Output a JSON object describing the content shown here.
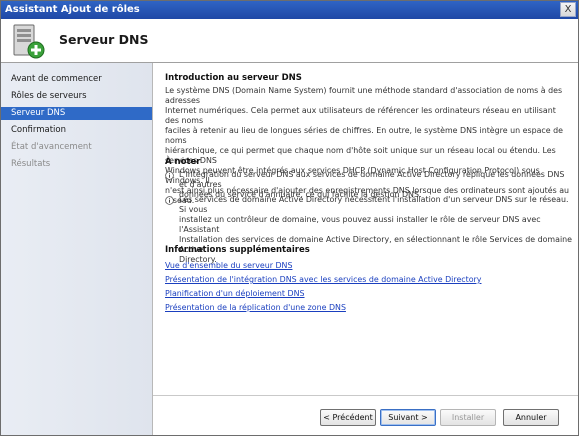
{
  "window": {
    "title": "Assistant Ajout de rôles",
    "close_label": "X"
  },
  "header": {
    "title": "Serveur DNS",
    "icon": "server-add-icon"
  },
  "sidebar": {
    "items": [
      {
        "label": "Avant de commencer",
        "state": "normal"
      },
      {
        "label": "Rôles de serveurs",
        "state": "normal"
      },
      {
        "label": "Serveur DNS",
        "state": "active"
      },
      {
        "label": "Confirmation",
        "state": "normal"
      },
      {
        "label": "État d'avancement",
        "state": "disabled"
      },
      {
        "label": "Résultats",
        "state": "disabled"
      }
    ]
  },
  "content": {
    "intro_heading": "Introduction au serveur DNS",
    "intro_lines": [
      "Le système DNS (Domain Name System) fournit une méthode standard d'association de noms à des adresses",
      "Internet numériques. Cela permet aux utilisateurs de référencer les ordinateurs réseau en utilisant des noms",
      "faciles à retenir au lieu de longues séries de chiffres. En outre, le système DNS intègre un espace de noms",
      "hiérarchique, ce qui permet que chaque nom d'hôte soit unique sur un réseau local ou étendu. Les services DNS",
      "Windows peuvent être intégrés aux services DHCP (Dynamic Host Configuration Protocol) sous Windows. Il",
      "n'est ainsi plus nécessaire d'ajouter des enregistrements DNS lorsque des ordinateurs sont ajoutés au réseau."
    ],
    "notes_heading": "À noter",
    "notes": [
      {
        "icon": "info-icon",
        "lines": [
          "L'intégration du serveur DNS aux services de domaine Active Directory réplique les données DNS et d'autres",
          "données du service d'annuaire, ce qui facilite la gestion DNS."
        ]
      },
      {
        "icon": "info-icon",
        "lines": [
          "Les services de domaine Active Directory nécessitent l'installation d'un serveur DNS sur le réseau. Si vous",
          "installez un contrôleur de domaine, vous pouvez aussi installer le rôle de serveur DNS avec l'Assistant",
          "Installation des services de domaine Active Directory, en sélectionnant le rôle Services de domaine Active",
          "Directory."
        ]
      }
    ],
    "more_heading": "Informations supplémentaires",
    "links": [
      "Vue d'ensemble du serveur DNS",
      "Présentation de l'intégration DNS avec les services de domaine Active Directory",
      "Planification d'un déploiement DNS",
      "Présentation de la réplication d'une zone DNS"
    ]
  },
  "footer": {
    "prev": "< Précédent",
    "next": "Suivant >",
    "install": "Installer",
    "cancel": "Annuler"
  }
}
